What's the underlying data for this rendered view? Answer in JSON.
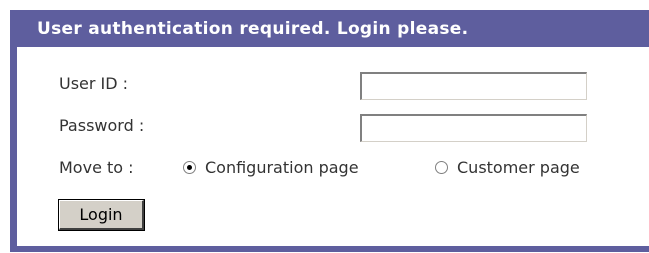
{
  "header": {
    "title": "User authentication required. Login please."
  },
  "form": {
    "user_id_label": "User ID :",
    "user_id_value": "",
    "password_label": "Password :",
    "password_value": "",
    "move_to_label": "Move to :",
    "options": [
      {
        "label": "Configuration page",
        "checked": true
      },
      {
        "label": "Customer page",
        "checked": false
      }
    ],
    "login_label": "Login"
  },
  "colors": {
    "accent": "#5e5e9e",
    "button_face": "#d4d0c8"
  }
}
